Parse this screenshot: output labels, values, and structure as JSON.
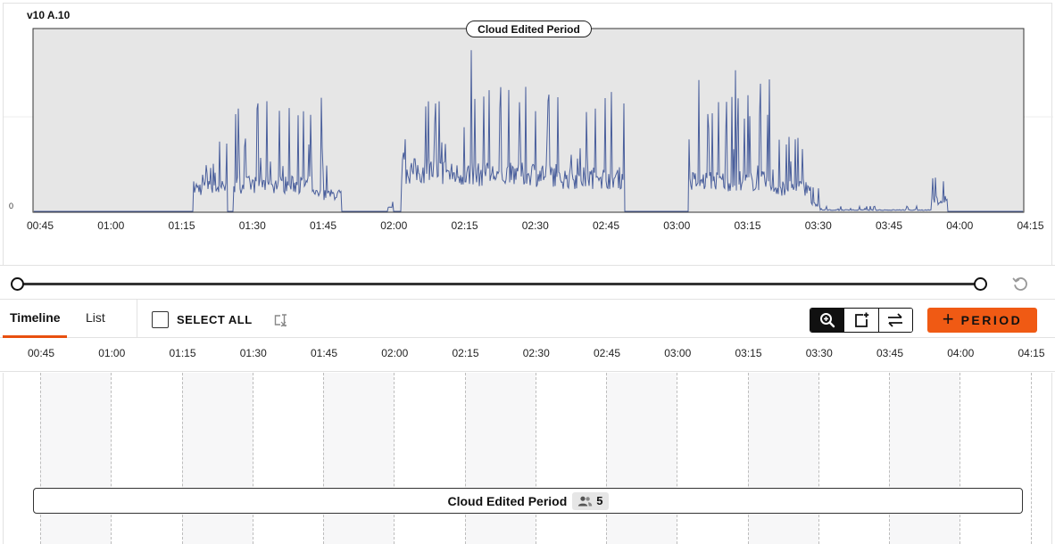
{
  "chart": {
    "device_label": "v10 A.10",
    "zero_label": "0",
    "period_pill_label": "Cloud Edited Period",
    "line_color": "#4a5f9c"
  },
  "time_ticks": [
    "00:45",
    "01:00",
    "01:15",
    "01:30",
    "01:45",
    "02:00",
    "02:15",
    "02:30",
    "02:45",
    "03:00",
    "03:15",
    "03:30",
    "03:45",
    "04:00",
    "04:15"
  ],
  "toolbar": {
    "tab_timeline": "Timeline",
    "tab_list": "List",
    "select_all": "SELECT ALL",
    "add_period_label": "PERIOD",
    "add_period_color": "#f05a14"
  },
  "timeline": {
    "period_name": "Cloud Edited Period",
    "participant_count": "5"
  }
}
